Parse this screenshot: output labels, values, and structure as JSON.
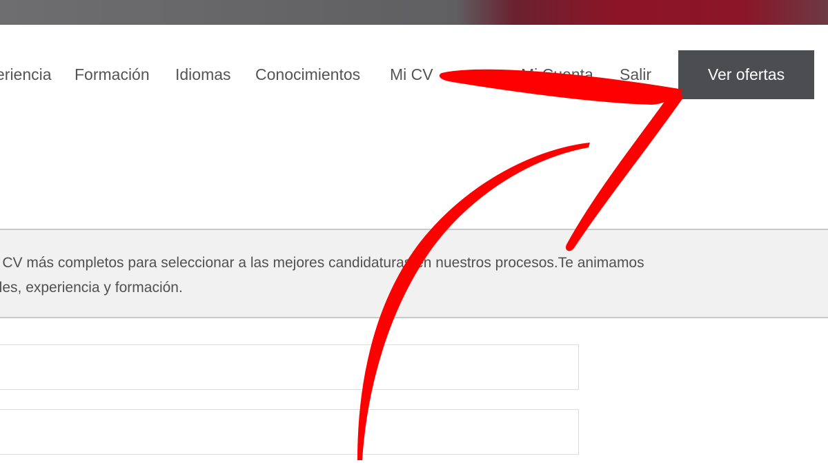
{
  "header": {
    "bar_colors": {
      "left": "#6e6e70",
      "right": "#8d1426"
    }
  },
  "nav": {
    "experiencia": "eriencia",
    "formacion": "Formación",
    "idiomas": "Idiomas",
    "conocimientos": "Conocimientos",
    "mi_cv": "Mi CV",
    "mi_cuenta": "Mi Cuenta",
    "salir": "Salir",
    "cta_label": "Ver ofertas",
    "cta_color": "#4b4d51"
  },
  "notice": {
    "line1": "s CV más completos para seleccionar a las mejores candidaturas en nuestros procesos.Te animamos",
    "line2": "ales, experiencia y formación."
  },
  "form": {
    "field1_value": "",
    "field2_value": ""
  },
  "annotation": {
    "arrow_color": "#ff0000"
  }
}
